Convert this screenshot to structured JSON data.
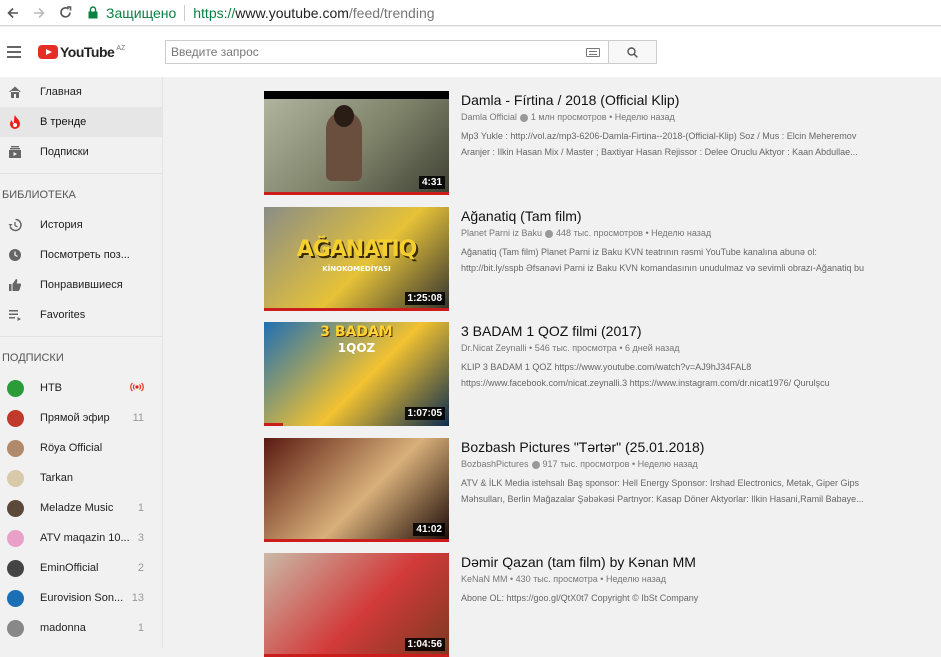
{
  "browser": {
    "secure_label": "Защищено",
    "url_scheme": "https://",
    "url_host": "www.youtube.com",
    "url_path": "/feed/trending"
  },
  "header": {
    "logo_text": "YouTube",
    "logo_country": "AZ",
    "search_placeholder": "Введите запрос"
  },
  "sidebar": {
    "main": [
      {
        "label": "Главная",
        "icon": "home-icon"
      },
      {
        "label": "В тренде",
        "icon": "flame-icon"
      },
      {
        "label": "Подписки",
        "icon": "subscriptions-icon"
      }
    ],
    "library_heading": "БИБЛИОТЕКА",
    "library": [
      {
        "label": "История",
        "icon": "history-icon"
      },
      {
        "label": "Посмотреть поз...",
        "icon": "clock-icon"
      },
      {
        "label": "Понравившиеся",
        "icon": "thumbs-up-icon"
      },
      {
        "label": "Favorites",
        "icon": "playlist-icon"
      }
    ],
    "subs_heading": "ПОДПИСКИ",
    "subscriptions": [
      {
        "label": "НТВ",
        "count": "",
        "live": true,
        "color": "#2a9d3a"
      },
      {
        "label": "Прямой эфир",
        "count": "11",
        "color": "#c0392b"
      },
      {
        "label": "Röya Official",
        "count": "",
        "color": "#b08a6a"
      },
      {
        "label": "Tarkan",
        "count": "",
        "color": "#d8c9a8"
      },
      {
        "label": "Meladze Music",
        "count": "1",
        "color": "#5b4a3a"
      },
      {
        "label": "ATV maqazin 10...",
        "count": "3",
        "color": "#e8a0c8"
      },
      {
        "label": "EminOfficial",
        "count": "2",
        "color": "#444444"
      },
      {
        "label": "Eurovision Son...",
        "count": "13",
        "color": "#1a6fb5"
      },
      {
        "label": "madonna",
        "count": "1",
        "color": "#888888"
      }
    ]
  },
  "videos": [
    {
      "title": "Damla - Fírtina / 2018 (Official Klip)",
      "channel": "Damla Official",
      "verified": true,
      "views": "1 млн просмотров",
      "age": "Неделю назад",
      "desc1": "Mp3 Yukle : http://vol.az/mp3-6206-Damla-Firtina--2018-(Official-Klip) Soz / Mus : Elcin Meheremov",
      "desc2": "Aranjer : Ilkin Hasan Mix / Master ; Baxtiyar Hasan Rejissor : Delee Oruclu Aktyor : Kaan Abdullae...",
      "duration": "4:31",
      "progress": 1.0,
      "thumb_colors": [
        "#b3b7a0",
        "#7d8168",
        "#3e3f33"
      ]
    },
    {
      "title": "Ağanatiq (Tam film)",
      "channel": "Planet Parni iz Baku",
      "verified": true,
      "views": "448 тыс. просмотров",
      "age": "Неделю назад",
      "desc1": "Ağanatiq (Tam film) Planet Parni iz Baku KVN teatrının rəsmi YouTube kanalına abunə ol:",
      "desc2": "http://bit.ly/sspb Əfsanəvi Parni iz Baku KVN komandasının unudulmaz və sevimli obrazı-Ağanatiq bu",
      "duration": "1:25:08",
      "progress": 1.0,
      "thumb_colors": [
        "#8a8d86",
        "#e6c238",
        "#2f3030"
      ],
      "thumb_text": "AĞANATIQ",
      "thumb_sub": "KİNOKOMEDİYASI"
    },
    {
      "title": "3 BADAM 1 QOZ filmi (2017)",
      "channel": "Dr.Nicat Zeynalli",
      "verified": false,
      "views": "546 тыс. просмотра",
      "age": "6 дней назад",
      "desc1": "KLIP 3 BADAM 1 QOZ https://www.youtube.com/watch?v=AJ9hJ34FAL8",
      "desc2": "https://www.facebook.com/nicat.zeynalli.3 https://www.instagram.com/dr.nicat1976/ Qurulşcu",
      "duration": "1:07:05",
      "progress": 0.1,
      "thumb_colors": [
        "#1f6fb3",
        "#f2c230",
        "#0d2c4f"
      ],
      "thumb_text": "3 BADAM",
      "thumb_sub": "1QOZ"
    },
    {
      "title": "Bozbash Pictures \"Tərtər\" (25.01.2018)",
      "channel": "BozbashPictures",
      "verified": true,
      "views": "917 тыс. просмотров",
      "age": "Неделю назад",
      "desc1": "ATV & İLK Media istehsalı Baş sponsor: Hell Energy Sponsor: Irshad Electronics, Metak, Giper Gips",
      "desc2": "Məhsulları, Berlin Mağazalar Şəbəkəsi Partnyor: Kasap Döner Aktyorlar: Ilkin Hasani,Ramil Babaye...",
      "duration": "41:02",
      "progress": 1.0,
      "thumb_colors": [
        "#5a1a12",
        "#d8b07a",
        "#1a0906"
      ]
    },
    {
      "title": "Dəmir Qazan (tam film) by Kənan MM",
      "channel": "KeNaN MM",
      "verified": false,
      "views": "430 тыс. просмотра",
      "age": "Неделю назад",
      "desc1": "Abone OL: https://goo.gl/QtX0t7 Copyright © IbSt Company",
      "desc2": "",
      "duration": "1:04:56",
      "progress": 1.0,
      "thumb_colors": [
        "#c9b9a8",
        "#d23a3a",
        "#7a3a20"
      ]
    }
  ],
  "accent_color": "#cc181e"
}
